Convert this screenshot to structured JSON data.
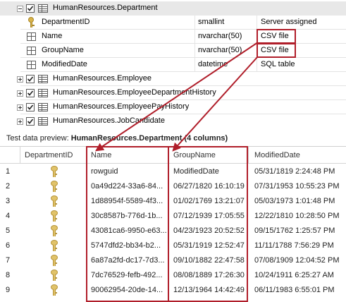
{
  "tree": {
    "department_table": "HumanResources.Department",
    "columns": [
      {
        "name": "DepartmentID",
        "type": "smallint",
        "source": "Server assigned",
        "icon": "key-icon"
      },
      {
        "name": "Name",
        "type": "nvarchar(50)",
        "source": "CSV file",
        "icon": "column-icon"
      },
      {
        "name": "GroupName",
        "type": "nvarchar(50)",
        "source": "CSV file",
        "icon": "column-icon"
      },
      {
        "name": "ModifiedDate",
        "type": "datetime",
        "source": "SQL table",
        "icon": "column-icon"
      }
    ],
    "other_tables": [
      "HumanResources.Employee",
      "HumanResources.EmployeeDepartmentHistory",
      "HumanResources.EmployeePayHistory",
      "HumanResources.JobCandidate"
    ]
  },
  "preview": {
    "label_prefix": "Test data preview: ",
    "label_table": "HumanResources.Department (4 columns)"
  },
  "grid": {
    "headers": [
      "DepartmentID",
      "Name",
      "GroupName",
      "ModifiedDate"
    ],
    "rows": [
      {
        "num": "1",
        "name": "rowguid",
        "group": "ModifiedDate",
        "date": "05/31/1819 2:24:48 PM"
      },
      {
        "num": "2",
        "name": "0a49d224-33a6-84...",
        "group": "06/27/1820 16:10:19",
        "date": "07/31/1953 10:55:23 PM"
      },
      {
        "num": "3",
        "name": "1d88954f-5589-4f3...",
        "group": "01/02/1769 13:21:07",
        "date": "05/03/1973 1:01:48 PM"
      },
      {
        "num": "4",
        "name": "30c8587b-776d-1b...",
        "group": "07/12/1939 17:05:55",
        "date": "12/22/1810 10:28:50 PM"
      },
      {
        "num": "5",
        "name": "43081ca6-9950-e63...",
        "group": "04/23/1923 20:52:52",
        "date": "09/15/1762 1:25:57 PM"
      },
      {
        "num": "6",
        "name": "5747dfd2-bb34-b2...",
        "group": "05/31/1919 12:52:47",
        "date": "11/11/1788 7:56:29 PM"
      },
      {
        "num": "7",
        "name": "6a87a2fd-dc17-7d3...",
        "group": "09/10/1882 22:47:58",
        "date": "07/08/1909 12:04:52 PM"
      },
      {
        "num": "8",
        "name": "7dc76529-fefb-492...",
        "group": "08/08/1889 17:26:30",
        "date": "10/24/1911 6:25:27 AM"
      },
      {
        "num": "9",
        "name": "90062954-20de-14...",
        "group": "12/13/1964 14:42:49",
        "date": "06/11/1983 6:55:01 PM"
      }
    ]
  },
  "colors": {
    "annotation": "#b01e2a",
    "key_gold": "#d9b44a",
    "header_highlight": "#e8e8e8"
  }
}
